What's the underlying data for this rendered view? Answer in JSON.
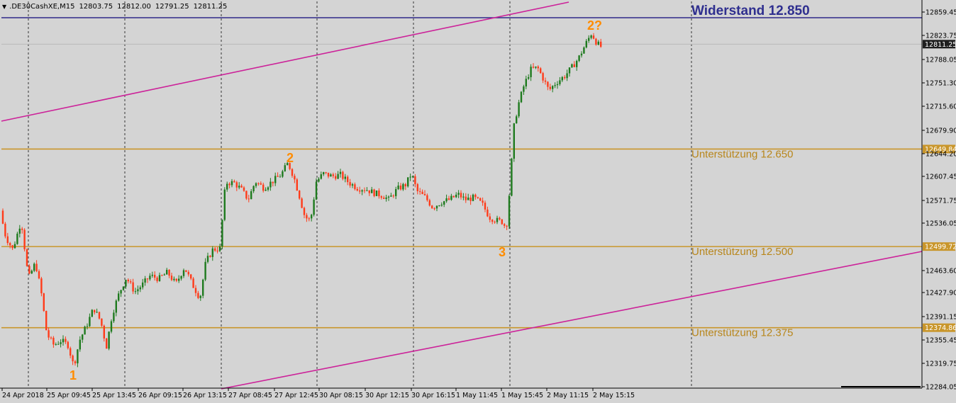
{
  "header": {
    "symbol": ".DE30CashXE,M15",
    "ohlc": [
      "12803.75",
      "12812.00",
      "12791.25",
      "12811.25"
    ]
  },
  "colors": {
    "background": "#d4d4d4",
    "bull": "#1e7a1e",
    "bear": "#ff3b1a",
    "support": "#c9962b",
    "resistance": "#2f2a8a",
    "channel": "#cc2299",
    "grid": "#333333"
  },
  "annotations": {
    "resistance": "Widerstand 12.850",
    "support_1": "Unterstützung 12.650",
    "support_2": "Unterstützung 12.500",
    "support_3": "Unterstützung 12.375",
    "wave_1": "1",
    "wave_2": "2",
    "wave_3": "3",
    "wave_2q": "2?"
  },
  "chart_data": {
    "type": "candlestick",
    "title": "",
    "price_range": [
      12284.05,
      12877.0
    ],
    "y_ticks": [
      "12859.45",
      "12823.75",
      "12788.05",
      "12751.30",
      "12715.60",
      "12679.90",
      "12644.20",
      "12607.45",
      "12571.75",
      "12536.05",
      "12499.72",
      "12463.60",
      "12427.90",
      "12391.15",
      "12355.45",
      "12319.75",
      "12284.05"
    ],
    "x_ticks": [
      "24 Apr 2018",
      "25 Apr 09:45",
      "25 Apr 13:45",
      "26 Apr 09:15",
      "26 Apr 13:15",
      "27 Apr 08:45",
      "27 Apr 12:45",
      "30 Apr 08:15",
      "30 Apr 12:15",
      "30 Apr 16:15",
      "1 May 11:45",
      "1 May 15:45",
      "2 May 11:15",
      "2 May 15:15"
    ],
    "current_price": "12811.25",
    "levels": [
      {
        "label": "Widerstand 12.850",
        "price": 12850.0,
        "role": "resistance"
      },
      {
        "label": "Unterstützung 12.650",
        "price": 12649.84,
        "role": "support",
        "tag": "12649.84"
      },
      {
        "label": "Unterstützung 12.500",
        "price": 12499.72,
        "role": "support",
        "tag": "12499.72"
      },
      {
        "label": "Unterstützung 12.375",
        "price": 12374.86,
        "role": "support",
        "tag": "12374.86"
      }
    ],
    "channel_lines": [
      {
        "points": [
          [
            "24 Apr 2018",
            12687
          ],
          [
            "2 May 11:15",
            12877
          ]
        ]
      },
      {
        "points": [
          [
            "27 Apr 08:45",
            12284
          ],
          [
            "2 May 15:15",
            12485
          ]
        ]
      }
    ],
    "wave_labels": [
      {
        "text": "1",
        "near": "25 Apr 09:45",
        "price": 12300
      },
      {
        "text": "2",
        "near": "27 Apr 12:45",
        "price": 12632
      },
      {
        "text": "3",
        "near": "1 May 15:45",
        "price": 12493
      },
      {
        "text": "2?",
        "near": "2 May 15:15",
        "price": 12835
      }
    ],
    "path": [
      [
        0,
        12555
      ],
      [
        8,
        12515
      ],
      [
        18,
        12495
      ],
      [
        30,
        12540
      ],
      [
        40,
        12450
      ],
      [
        50,
        12475
      ],
      [
        58,
        12430
      ],
      [
        66,
        12365
      ],
      [
        76,
        12348
      ],
      [
        86,
        12355
      ],
      [
        96,
        12348
      ],
      [
        104,
        12315
      ],
      [
        112,
        12355
      ],
      [
        122,
        12378
      ],
      [
        132,
        12405
      ],
      [
        142,
        12385
      ],
      [
        150,
        12345
      ],
      [
        158,
        12395
      ],
      [
        168,
        12428
      ],
      [
        178,
        12452
      ],
      [
        190,
        12430
      ],
      [
        200,
        12440
      ],
      [
        212,
        12455
      ],
      [
        224,
        12450
      ],
      [
        236,
        12460
      ],
      [
        248,
        12442
      ],
      [
        260,
        12468
      ],
      [
        272,
        12440
      ],
      [
        282,
        12420
      ],
      [
        290,
        12475
      ],
      [
        300,
        12495
      ],
      [
        310,
        12497
      ],
      [
        318,
        12598
      ],
      [
        330,
        12598
      ],
      [
        340,
        12588
      ],
      [
        350,
        12572
      ],
      [
        360,
        12600
      ],
      [
        372,
        12590
      ],
      [
        384,
        12600
      ],
      [
        396,
        12610
      ],
      [
        406,
        12628
      ],
      [
        414,
        12608
      ],
      [
        422,
        12578
      ],
      [
        430,
        12545
      ],
      [
        438,
        12540
      ],
      [
        446,
        12600
      ],
      [
        456,
        12612
      ],
      [
        468,
        12608
      ],
      [
        480,
        12610
      ],
      [
        492,
        12598
      ],
      [
        504,
        12590
      ],
      [
        516,
        12588
      ],
      [
        528,
        12582
      ],
      [
        540,
        12578
      ],
      [
        548,
        12572
      ],
      [
        560,
        12588
      ],
      [
        572,
        12595
      ],
      [
        580,
        12612
      ],
      [
        588,
        12585
      ],
      [
        600,
        12575
      ],
      [
        610,
        12560
      ],
      [
        622,
        12568
      ],
      [
        634,
        12572
      ],
      [
        646,
        12580
      ],
      [
        656,
        12572
      ],
      [
        668,
        12575
      ],
      [
        680,
        12565
      ],
      [
        690,
        12545
      ],
      [
        700,
        12540
      ],
      [
        708,
        12538
      ],
      [
        714,
        12528
      ],
      [
        720,
        12605
      ],
      [
        724,
        12680
      ],
      [
        730,
        12715
      ],
      [
        738,
        12745
      ],
      [
        748,
        12772
      ],
      [
        758,
        12775
      ],
      [
        766,
        12758
      ],
      [
        774,
        12740
      ],
      [
        784,
        12752
      ],
      [
        796,
        12762
      ],
      [
        806,
        12775
      ],
      [
        816,
        12790
      ],
      [
        826,
        12812
      ],
      [
        834,
        12828
      ],
      [
        842,
        12812
      ],
      [
        850,
        12805
      ]
    ]
  }
}
